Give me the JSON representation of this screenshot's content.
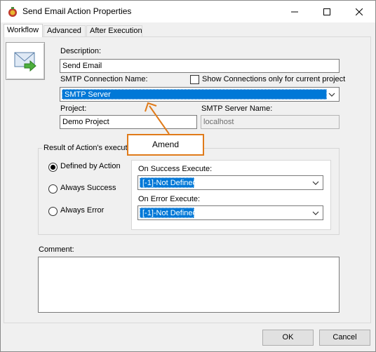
{
  "window": {
    "title": "Send Email Action Properties"
  },
  "tabs": [
    {
      "label": "Workflow",
      "active": true
    },
    {
      "label": "Advanced",
      "active": false
    },
    {
      "label": "After Execution",
      "active": false
    }
  ],
  "fields": {
    "description_label": "Description:",
    "description_value": "Send Email",
    "smtp_connection_label": "SMTP Connection Name:",
    "show_connections_label": "Show Connections only for current project",
    "show_connections_checked": false,
    "smtp_connection_value": "SMTP Server",
    "project_label": "Project:",
    "project_value": "Demo Project",
    "smtp_server_label": "SMTP Server Name:",
    "smtp_server_value": "localhost"
  },
  "result_group": {
    "title": "Result of Action's execution",
    "options": [
      {
        "label": "Defined by  Action",
        "selected": true
      },
      {
        "label": "Always Success",
        "selected": false
      },
      {
        "label": "Always Error",
        "selected": false
      }
    ],
    "on_success_label": "On Success Execute:",
    "on_success_value": "[-1]-Not Defined",
    "on_error_label": "On Error Execute:",
    "on_error_value": "[-1]-Not Defined"
  },
  "comment": {
    "label": "Comment:",
    "value": ""
  },
  "buttons": {
    "ok": "OK",
    "cancel": "Cancel"
  },
  "annotation": {
    "text": "Amend",
    "color": "#e07b1a"
  },
  "colors": {
    "selection": "#0078d7",
    "face": "#f0f0f0"
  }
}
